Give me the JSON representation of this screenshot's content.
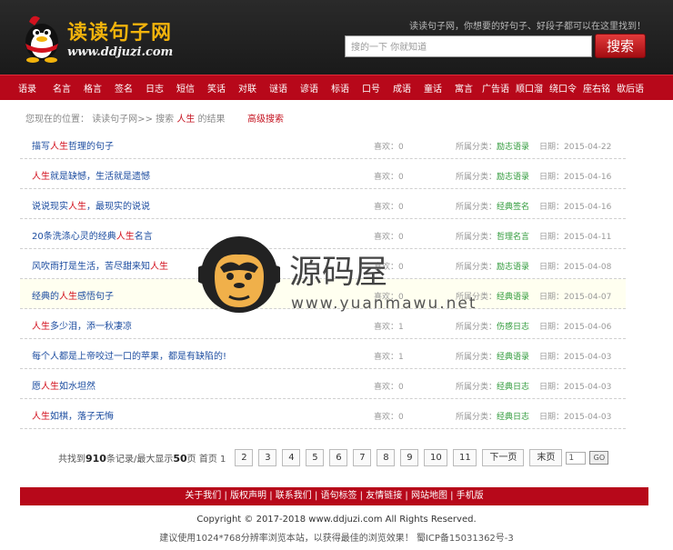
{
  "header": {
    "logo_text": "读读句子网",
    "logo_url": "www.ddjuzi.com",
    "tagline": "读读句子网，你想要的好句子、好段子都可以在这里找到！",
    "search_placeholder": "搜的一下 你就知道",
    "search_button": "搜索"
  },
  "nav": [
    "语录",
    "名言",
    "格言",
    "签名",
    "日志",
    "短信",
    "笑话",
    "对联",
    "谜语",
    "谚语",
    "标语",
    "口号",
    "成语",
    "童话",
    "寓言",
    "广告语",
    "顺口溜",
    "绕口令",
    "座右铭",
    "歇后语"
  ],
  "breadcrumb": {
    "prefix": "您现在的位置：",
    "site": "读读句子网>>",
    "search": "搜索",
    "keyword": "人生",
    "suffix": "的结果",
    "advanced": "高级搜索"
  },
  "results": [
    {
      "pre": "描写",
      "kw": "人生",
      "post": "哲理的句子",
      "likes": "喜欢：0",
      "cat_label": "所属分类：",
      "cat": "励志语录",
      "date": "日期：2015-04-22"
    },
    {
      "pre": "",
      "kw": "人生",
      "post": "就是缺憾，生活就是遗憾",
      "likes": "喜欢：0",
      "cat_label": "所属分类：",
      "cat": "励志语录",
      "date": "日期：2015-04-16"
    },
    {
      "pre": "说说现实",
      "kw": "人生",
      "post": "，最现实的说说",
      "likes": "喜欢：0",
      "cat_label": "所属分类：",
      "cat": "经典签名",
      "date": "日期：2015-04-16"
    },
    {
      "pre": "20条洗涤心灵的经典",
      "kw": "人生",
      "post": "名言",
      "likes": "喜欢：0",
      "cat_label": "所属分类：",
      "cat": "哲理名言",
      "date": "日期：2015-04-11"
    },
    {
      "pre": "风吹雨打是生活，苦尽甜来知",
      "kw": "人生",
      "post": "",
      "likes": "喜欢：0",
      "cat_label": "所属分类：",
      "cat": "励志语录",
      "date": "日期：2015-04-08"
    },
    {
      "pre": "经典的",
      "kw": "人生",
      "post": "感悟句子",
      "likes": "喜欢：0",
      "cat_label": "所属分类：",
      "cat": "经典语录",
      "date": "日期：2015-04-07"
    },
    {
      "pre": "",
      "kw": "人生",
      "post": "多少泪，添一秋凄凉",
      "likes": "喜欢：1",
      "cat_label": "所属分类：",
      "cat": "伤感日志",
      "date": "日期：2015-04-06"
    },
    {
      "pre": "每个人都是上帝咬过一口的苹果，都是有缺陷的!",
      "kw": "",
      "post": "",
      "likes": "喜欢：1",
      "cat_label": "所属分类：",
      "cat": "经典语录",
      "date": "日期：2015-04-03"
    },
    {
      "pre": "愿",
      "kw": "人生",
      "post": "如水坦然",
      "likes": "喜欢：0",
      "cat_label": "所属分类：",
      "cat": "经典日志",
      "date": "日期：2015-04-03"
    },
    {
      "pre": "",
      "kw": "人生",
      "post": "如棋，落子无悔",
      "likes": "喜欢：0",
      "cat_label": "所属分类：",
      "cat": "经典日志",
      "date": "日期：2015-04-03"
    }
  ],
  "watermark": {
    "text": "源码屋",
    "url": "www.yuanmawu.net"
  },
  "pager": {
    "pre": "共找到",
    "total": "910",
    "mid": "条记录/最大显示",
    "max": "50",
    "post": "页 首页 1",
    "pages": [
      "2",
      "3",
      "4",
      "5",
      "6",
      "7",
      "8",
      "9",
      "10",
      "11"
    ],
    "next": "下一页",
    "last": "末页",
    "input_value": "1",
    "go": "GO"
  },
  "footer": {
    "links": "关于我们 | 版权声明 | 联系我们 | 语句标签 | 友情链接 | 网站地图 | 手机版",
    "copyright": "Copyright © 2017-2018 www.ddjuzi.com All Rights Reserved.",
    "advice": "建议使用1024*768分辨率浏览本站，以获得最佳的浏览效果！ 蜀ICP备15031362号-3"
  },
  "colors": {
    "brand_red": "#b7081a",
    "link_blue": "#1d4da0",
    "keyword_red": "#d2121f",
    "category_green": "#2f9a3a"
  }
}
